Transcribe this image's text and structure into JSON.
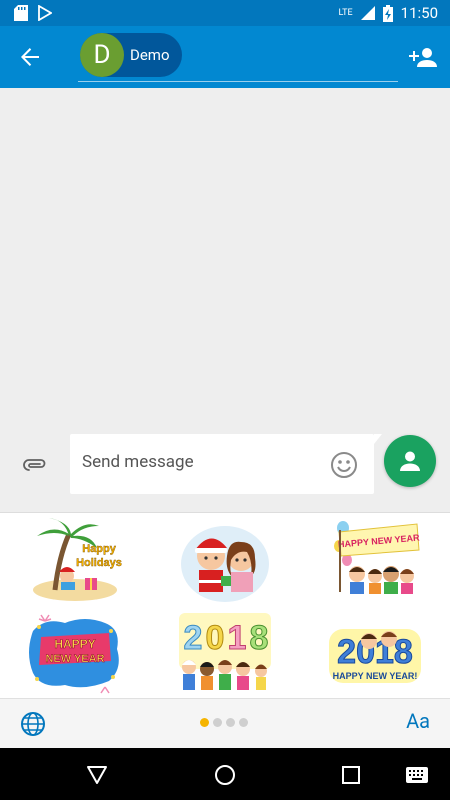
{
  "status_bar": {
    "time": "11:50",
    "network_label": "LTE",
    "icons": [
      "sd-card-icon",
      "play-store-icon",
      "signal-icon",
      "battery-charging-icon"
    ]
  },
  "app_bar": {
    "recipient": {
      "initial": "D",
      "name": "Demo",
      "avatar_color": "#6a9e31"
    },
    "accent_color": "#0288d1"
  },
  "compose": {
    "placeholder": "Send message",
    "send_color": "#1aa260"
  },
  "stickers": [
    {
      "name": "sticker-happy-holidays",
      "text": "Happy Holidays"
    },
    {
      "name": "sticker-christmas-kids",
      "text": ""
    },
    {
      "name": "sticker-happy-new-year-banner",
      "text": "HAPPY NEW YEAR"
    },
    {
      "name": "sticker-happy-new-year-fireworks",
      "text": "HAPPY NEW YEAR"
    },
    {
      "name": "sticker-2018-balloons",
      "text": "2018"
    },
    {
      "name": "sticker-2018-happy-new-year",
      "text": "2018",
      "subtext": "HAPPY NEW YEAR!"
    }
  ],
  "panel_footer": {
    "font_button": "Aa",
    "pages": 4,
    "active_page": 1
  }
}
